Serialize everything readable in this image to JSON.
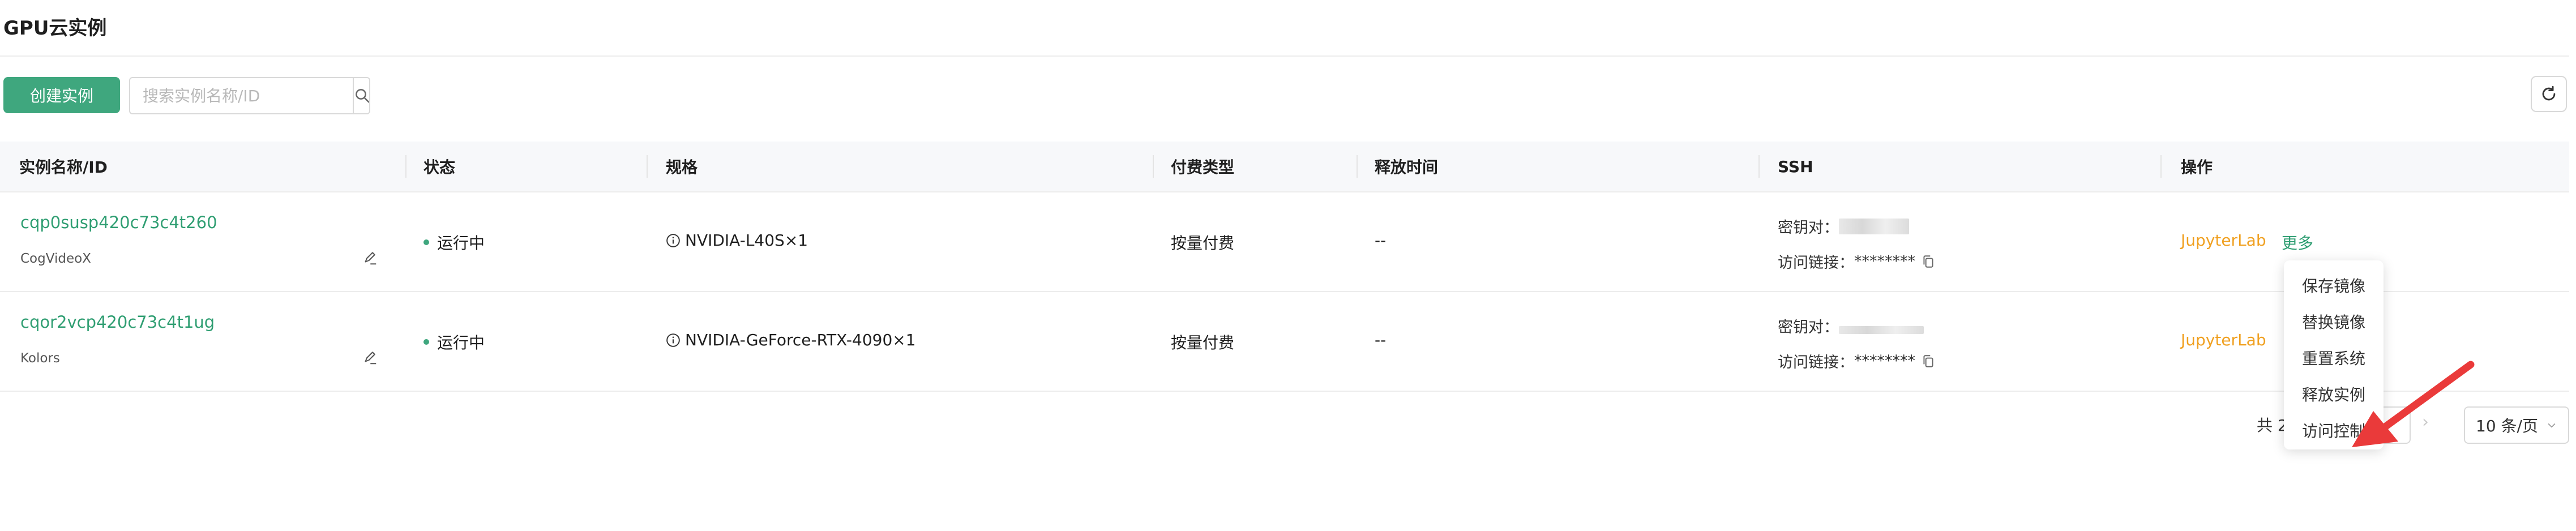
{
  "page": {
    "title": "GPU云实例"
  },
  "toolbar": {
    "create_label": "创建实例",
    "search_placeholder": "搜索实例名称/ID"
  },
  "table": {
    "columns": [
      "实例名称/ID",
      "状态",
      "规格",
      "付费类型",
      "释放时间",
      "SSH",
      "操作"
    ],
    "rows": [
      {
        "id": "cqp0susp420c73c4t260",
        "name": "CogVideoX",
        "status": "运行中",
        "spec": "NVIDIA-L40S×1",
        "billing": "按量付费",
        "release": "--",
        "ssh_key_label": "密钥对：",
        "ssh_link_label": "访问链接：",
        "ssh_link_value": "********",
        "action_primary": "JupyterLab",
        "action_more": "更多"
      },
      {
        "id": "cqor2vcp420c73c4t1ug",
        "name": "Kolors",
        "status": "运行中",
        "spec": "NVIDIA-GeForce-RTX-4090×1",
        "billing": "按量付费",
        "release": "--",
        "ssh_key_label": "密钥对：",
        "ssh_link_label": "访问链接：",
        "ssh_link_value": "********",
        "action_primary": "JupyterLab"
      }
    ]
  },
  "dropdown": {
    "items": [
      "保存镜像",
      "替换镜像",
      "重置系统",
      "释放实例",
      "访问控制"
    ]
  },
  "pagination": {
    "total_prefix": "共 2",
    "page_size_label": "10 条/页"
  },
  "colors": {
    "accent": "#3fa77e",
    "action": "#f0a020",
    "annotation_arrow": "#ea3a3a"
  }
}
